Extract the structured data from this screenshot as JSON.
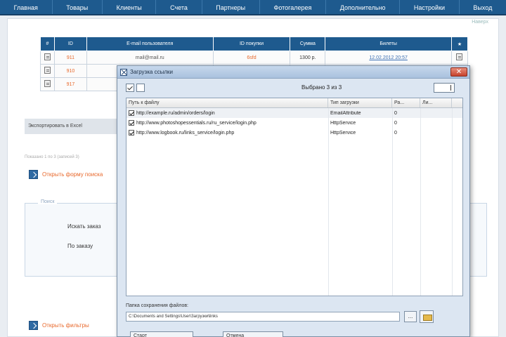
{
  "nav": {
    "items": [
      "Главная",
      "Товары",
      "Клиенты",
      "Счета",
      "Партнеры",
      "Фотогалерея",
      "Дополнительно",
      "Настройки",
      "Выход"
    ]
  },
  "page": {
    "top_link": "Наверх",
    "table": {
      "headers": [
        "#",
        "ID",
        "E-mail пользователя",
        "ID покупки",
        "Сумма",
        "Билеты",
        "★"
      ],
      "rows": [
        {
          "id": "911",
          "email": "mail@mail.ru",
          "login": "6sfd",
          "sum": "1300 р.",
          "dates": "12.02.2012 20:57"
        },
        {
          "id": "910",
          "email": "",
          "login": "",
          "sum": "",
          "dates": ""
        },
        {
          "id": "917",
          "email": "",
          "login": "",
          "sum": "",
          "dates": ""
        }
      ]
    },
    "export_label": "Экспортировать в Excel",
    "shown_line": "Показано 1 по 3 (записей 3)",
    "open_form_label": "Открыть форму поиска",
    "search": {
      "legend": "Поиск",
      "row1": "Искать заказ",
      "row2": "По заказу"
    },
    "open_filter_label": "Открыть фильтры"
  },
  "dialog": {
    "title": "Загрузка ссылки",
    "close_label": "✕",
    "selected_text": "Выбрано 3 из 3",
    "list": {
      "headers": [
        "Путь к файлу",
        "Тип загрузки",
        "Ра...",
        "Ли..."
      ],
      "rows": [
        {
          "url": "http://example.ru/admin/orders/login",
          "type": "EmailAttribute",
          "size": "0"
        },
        {
          "url": "http://www.photoshopessentials.ru/ru_service/login.php",
          "type": "HttpService",
          "size": "0"
        },
        {
          "url": "http://www.logbook.ru/links_service/login.php",
          "type": "HttpService",
          "size": "0"
        }
      ]
    },
    "save_label": "Папка сохранения файлов:",
    "save_path": "C:\\Documents and Settings\\User\\Загрузки\\links",
    "dots_label": "...",
    "button1": "Старт",
    "button2": "Отмена"
  }
}
